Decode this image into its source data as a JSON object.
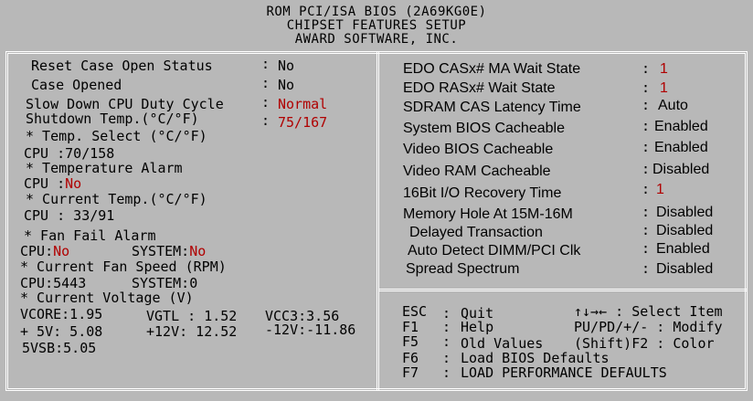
{
  "header": {
    "line1": "ROM PCI/ISA BIOS (2A69KG0E)",
    "line2": "CHIPSET FEATURES SETUP",
    "line3": "AWARD SOFTWARE, INC."
  },
  "left": {
    "reset_case_label": "Reset Case Open Status",
    "reset_case_value": "No",
    "case_opened_label": "Case Opened",
    "case_opened_value": "No",
    "slow_down_label": "Slow Down CPU Duty Cycle",
    "slow_down_value": "Normal",
    "shutdown_label": "Shutdown Temp.(°C/°F)",
    "shutdown_value": "75/167",
    "temp_select_label": "* Temp. Select (°C/°F)",
    "temp_select_cpu": "CPU :70/158",
    "temp_alarm_label": "* Temperature Alarm",
    "temp_alarm_cpu_prefix": "CPU :",
    "temp_alarm_cpu_value": "No",
    "current_temp_label": "* Current Temp.(°C/°F)",
    "current_temp_cpu": "CPU : 33/91",
    "fan_fail_label": "* Fan Fail Alarm",
    "fan_fail_cpu_prefix": "CPU:",
    "fan_fail_cpu_value": "No",
    "fan_fail_sys_prefix": "SYSTEM:",
    "fan_fail_sys_value": "No",
    "fan_speed_label": "* Current Fan Speed (RPM)",
    "fan_speed_cpu": "CPU:5443",
    "fan_speed_sys": "SYSTEM:0",
    "voltage_label": "* Current Voltage (V)",
    "vcore": "VCORE:1.95",
    "vgtl": "VGTL : 1.52",
    "vcc3": "VCC3:3.56",
    "v5": "+ 5V: 5.08",
    "v12": "+12V: 12.52",
    "vneg12": "-12V:-11.86",
    "v5sb": "5VSB:5.05"
  },
  "right": {
    "items": [
      {
        "label": "EDO CASx# MA Wait State",
        "value": "1"
      },
      {
        "label": "EDO RASx# Wait State",
        "value": "1"
      },
      {
        "label": "SDRAM CAS Latency Time",
        "value": "Auto"
      },
      {
        "label": "System BIOS Cacheable",
        "value": "Enabled"
      },
      {
        "label": "Video BIOS Cacheable",
        "value": "Enabled"
      },
      {
        "label": "Video RAM Cacheable",
        "value": "Disabled"
      },
      {
        "label": "16Bit I/O Recovery Time",
        "value": "1"
      },
      {
        "label": "Memory Hole At 15M-16M",
        "value": "Disabled"
      },
      {
        "label": "Delayed Transaction",
        "value": "Disabled"
      },
      {
        "label": "Auto Detect DIMM/PCI Clk",
        "value": "Enabled"
      },
      {
        "label": "Spread Spectrum",
        "value": "Disabled"
      }
    ]
  },
  "help": {
    "esc_key": "ESC",
    "esc_desc": "Quit",
    "f1_key": "F1",
    "f1_desc": "Help",
    "f5_key": "F5",
    "f5_desc": "Old Values",
    "f6_key": "F6",
    "f6_desc": "Load BIOS  Defaults",
    "f7_key": "F7",
    "f7_desc": "LOAD PERFORMANCE DEFAULTS",
    "select_item": "↑↓→← : Select Item",
    "modify": "PU/PD/+/- : Modify",
    "color": "(Shift)F2 : Color"
  }
}
